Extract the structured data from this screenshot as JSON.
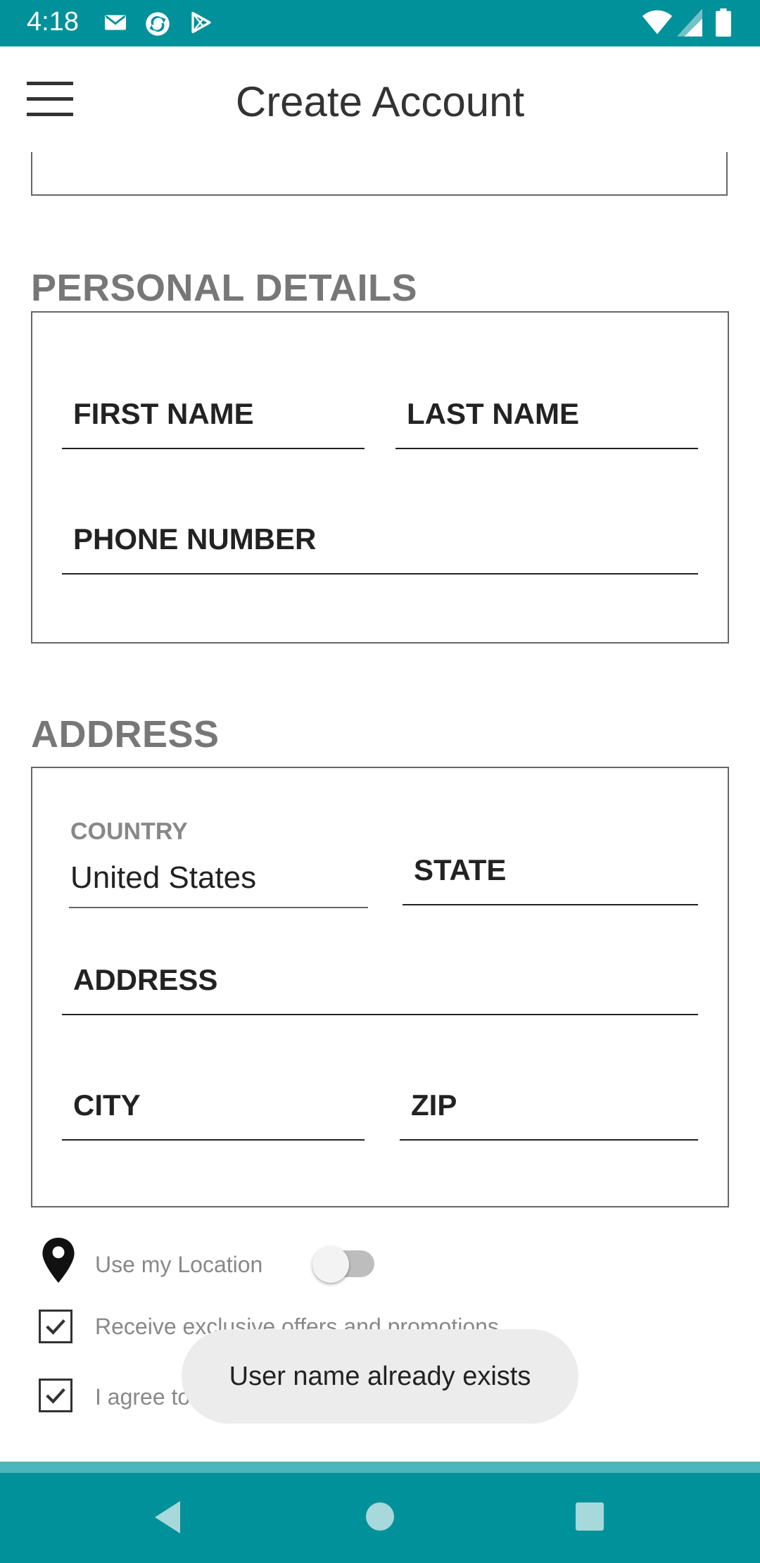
{
  "status_bar": {
    "time": "4:18",
    "icons": [
      "gmail-icon",
      "sync-app-icon",
      "play-store-icon",
      "wifi-icon",
      "signal-icon",
      "battery-icon"
    ]
  },
  "app_bar": {
    "title": "Create Account",
    "menu_icon": "hamburger-menu-icon"
  },
  "personal_details": {
    "heading": "PERSONAL DETAILS",
    "first_name_label": "FIRST NAME",
    "last_name_label": "LAST NAME",
    "phone_label": "PHONE NUMBER"
  },
  "address": {
    "heading": "ADDRESS",
    "country_label": "COUNTRY",
    "country_value": "United States",
    "state_label": "STATE",
    "address_label": "ADDRESS",
    "city_label": "CITY",
    "zip_label": "ZIP"
  },
  "options": {
    "location_label": "Use my Location",
    "location_on": false,
    "offers_label": "Receive exclusive offers and promotions",
    "offers_checked": true,
    "agree_label": "I agree to the Advantage.com Conditions",
    "agree_checked": true
  },
  "toast": {
    "message": "User name already exists"
  },
  "colors": {
    "teal": "#01919b",
    "section_heading": "#777777"
  }
}
